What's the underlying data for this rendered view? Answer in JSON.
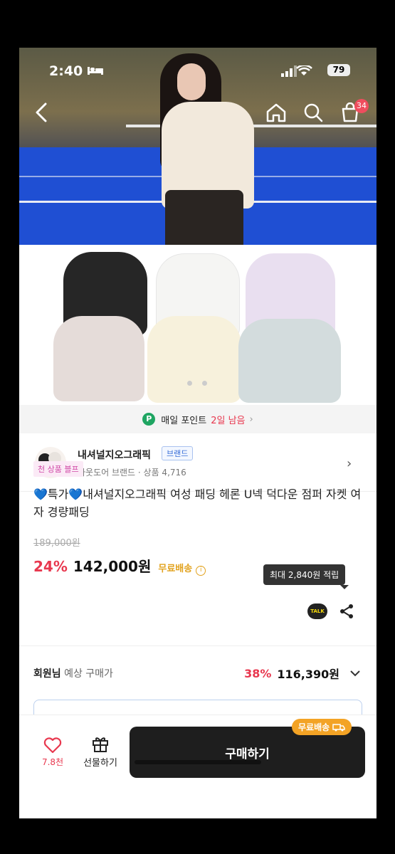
{
  "status_bar": {
    "time": "2:40",
    "battery": "79"
  },
  "nav": {
    "cart_count": "34"
  },
  "points_bar": {
    "icon": "P",
    "label": "매일 포인트",
    "highlight": "2일 남음",
    "arrow": "›"
  },
  "brand": {
    "name": "내셔널지오그래픽",
    "tag": "브랜드",
    "subtitle": "아웃도어 브랜드 · 상품 4,716"
  },
  "product": {
    "badge": "천 상품 블프",
    "title": "💙특가💙내셔널지오그래픽 여성 패딩 헤론 U넥 덕다운 점퍼 자켓 여자 경량패딩",
    "original_price": "189,000원",
    "discount": "24%",
    "price": "142,000원",
    "free_shipping": "무료배송",
    "tooltip": "최대 2,840원 적립",
    "talk_label": "TALK"
  },
  "member_price": {
    "label_bold": "회원님",
    "label_rest": " 예상 구매가",
    "discount": "38%",
    "price": "116,390원"
  },
  "bottom_bar": {
    "like_count": "7.8천",
    "gift_label": "선물하기",
    "buy_label": "구매하기",
    "free_pill": "무료배송"
  },
  "colors": {
    "accent_red": "#e8384f",
    "free_orange": "#e2a21d",
    "buy_button": "#1e1e1e"
  }
}
